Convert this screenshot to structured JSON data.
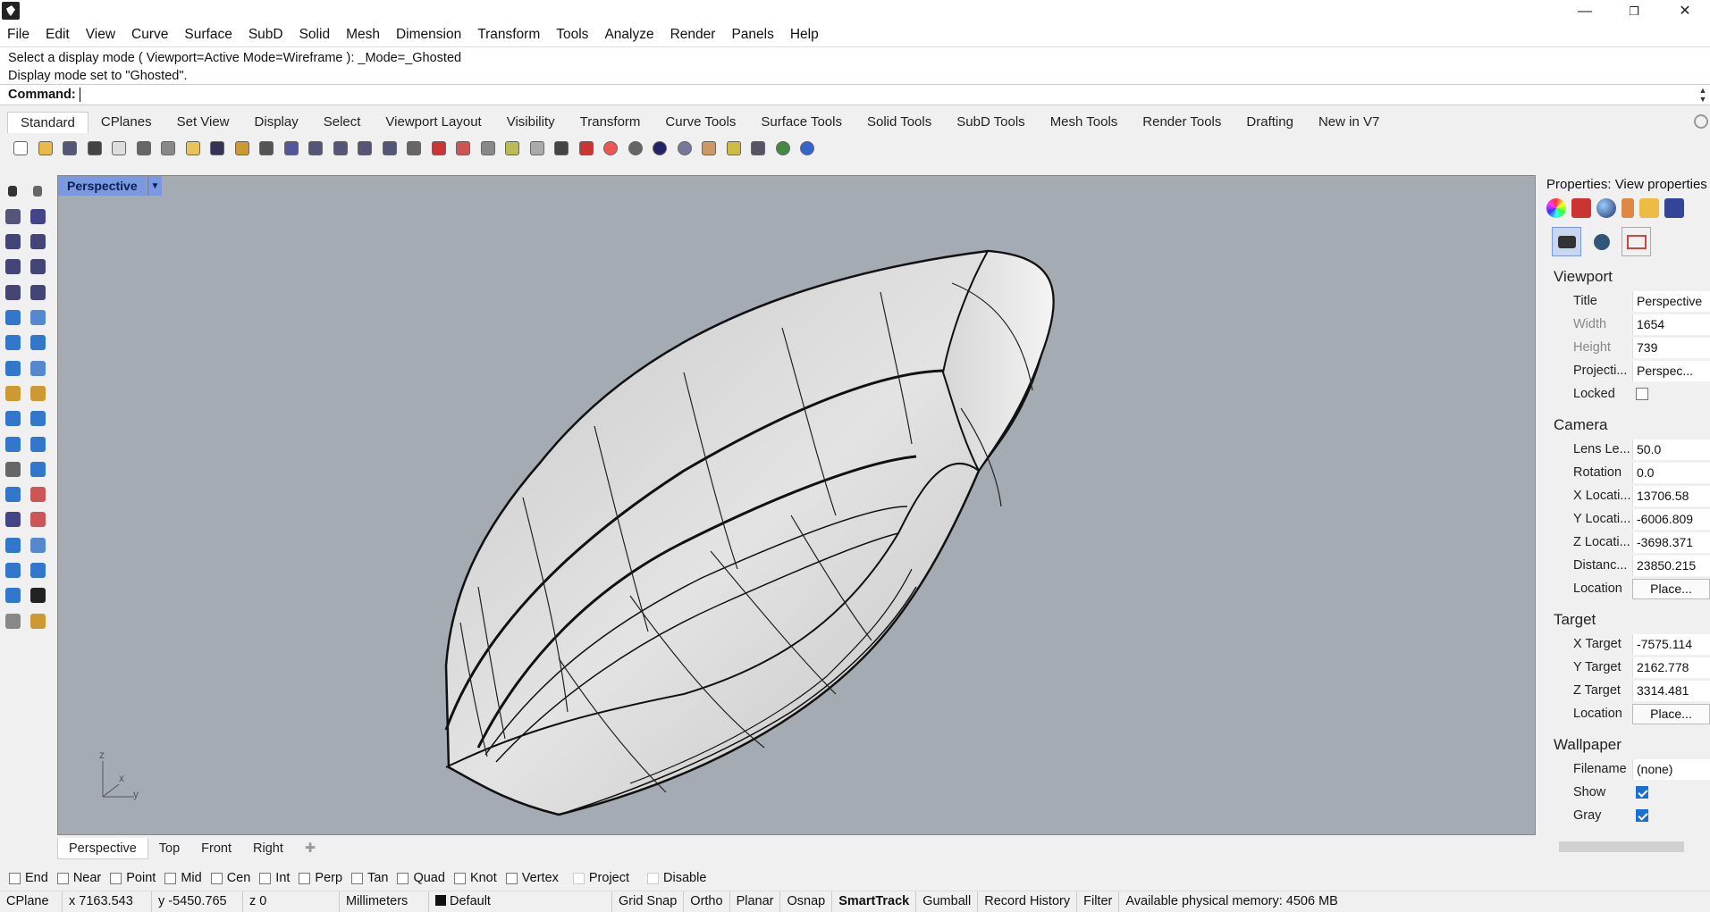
{
  "window": {
    "minimize": "—",
    "maximize": "❐",
    "close": "✕"
  },
  "menu": [
    "File",
    "Edit",
    "View",
    "Curve",
    "Surface",
    "SubD",
    "Solid",
    "Mesh",
    "Dimension",
    "Transform",
    "Tools",
    "Analyze",
    "Render",
    "Panels",
    "Help"
  ],
  "command_history": [
    "Select a display mode ( Viewport=Active  Mode=Wireframe ): _Mode=_Ghosted",
    "Display mode set to \"Ghosted\"."
  ],
  "command_prompt": "Command:",
  "toolbar_tabs": [
    "Standard",
    "CPlanes",
    "Set View",
    "Display",
    "Select",
    "Viewport Layout",
    "Visibility",
    "Transform",
    "Curve Tools",
    "Surface Tools",
    "Solid Tools",
    "SubD Tools",
    "Mesh Tools",
    "Render Tools",
    "Drafting",
    "New in V7"
  ],
  "toolbar_icons": [
    "new-icon",
    "open-icon",
    "save-icon",
    "print-icon",
    "import-icon",
    "cut-icon",
    "copy-icon",
    "paste-icon",
    "undo-icon",
    "pan-icon",
    "rotate-view-icon",
    "zoom-icon",
    "zoom-window-icon",
    "zoom-extents-icon",
    "zoom-selected-icon",
    "rotate-icon",
    "four-views-icon",
    "car-icon",
    "hide-icon",
    "show-icon",
    "point-edit-icon",
    "light-icon",
    "lock-icon",
    "material-icon",
    "color-wheel-icon",
    "shade-icon",
    "render-sphere-icon",
    "render-preview-icon",
    "properties-icon",
    "options-icon",
    "layout-icon",
    "rhino-web-icon",
    "help-icon"
  ],
  "viewport": {
    "label": "Perspective",
    "axes": {
      "z": "z",
      "x": "x",
      "y": "y"
    }
  },
  "viewport_tabs": [
    "Perspective",
    "Top",
    "Front",
    "Right"
  ],
  "viewport_tab_add": "✚",
  "properties": {
    "title": "Properties: View properties",
    "viewport_section": "Viewport",
    "camera_section": "Camera",
    "target_section": "Target",
    "wallpaper_section": "Wallpaper",
    "rows": {
      "title": {
        "label": "Title",
        "value": "Perspective"
      },
      "width": {
        "label": "Width",
        "value": "1654"
      },
      "height": {
        "label": "Height",
        "value": "739"
      },
      "projection": {
        "label": "Projecti...",
        "value": "Perspec..."
      },
      "locked": {
        "label": "Locked"
      },
      "lens": {
        "label": "Lens Le...",
        "value": "50.0"
      },
      "rotation": {
        "label": "Rotation",
        "value": "0.0"
      },
      "xloc": {
        "label": "X Locati...",
        "value": "13706.58"
      },
      "yloc": {
        "label": "Y Locati...",
        "value": "-6006.809"
      },
      "zloc": {
        "label": "Z Locati...",
        "value": "-3698.371"
      },
      "distance": {
        "label": "Distanc...",
        "value": "23850.215"
      },
      "cam_location": {
        "label": "Location",
        "value": "Place..."
      },
      "xtarget": {
        "label": "X Target",
        "value": "-7575.114"
      },
      "ytarget": {
        "label": "Y Target",
        "value": "2162.778"
      },
      "ztarget": {
        "label": "Z Target",
        "value": "3314.481"
      },
      "tgt_location": {
        "label": "Location",
        "value": "Place..."
      },
      "filename": {
        "label": "Filename",
        "value": "(none)"
      },
      "show": {
        "label": "Show"
      },
      "gray": {
        "label": "Gray"
      }
    }
  },
  "osnaps": [
    "End",
    "Near",
    "Point",
    "Mid",
    "Cen",
    "Int",
    "Perp",
    "Tan",
    "Quad",
    "Knot",
    "Vertex",
    "Project",
    "Disable"
  ],
  "status": {
    "cplane": "CPlane",
    "x": "x 7163.543",
    "y": "y -5450.765",
    "z": "z 0",
    "units": "Millimeters",
    "layer": "Default",
    "grid_snap": "Grid Snap",
    "ortho": "Ortho",
    "planar": "Planar",
    "osnap": "Osnap",
    "smarttrack": "SmartTrack",
    "gumball": "Gumball",
    "record_history": "Record History",
    "filter": "Filter",
    "memory": "Available physical memory: 4506 MB"
  }
}
